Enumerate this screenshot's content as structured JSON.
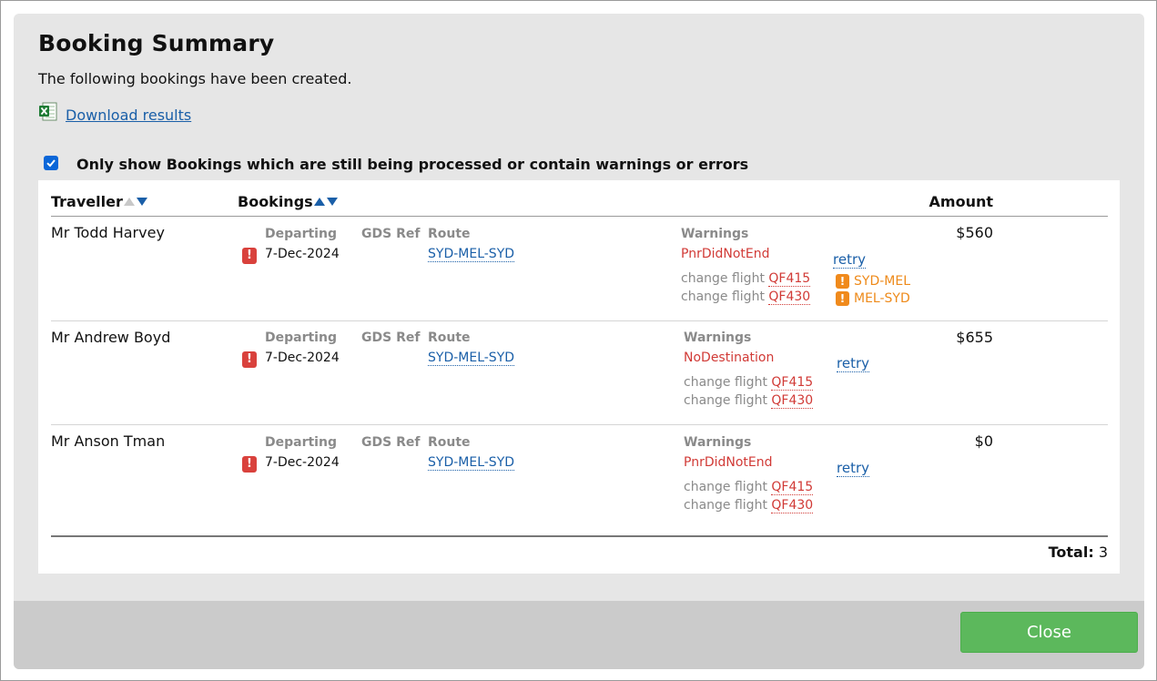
{
  "dialog": {
    "title": "Booking Summary",
    "intro": "The following bookings have been created.",
    "download_label": "Download results",
    "filter_label": "Only show Bookings which are still being processed or contain warnings or errors",
    "filter_checked": true
  },
  "table": {
    "headers": {
      "traveller": "Traveller",
      "bookings": "Bookings",
      "amount": "Amount"
    },
    "sub_headers": {
      "departing": "Departing",
      "gds_ref": "GDS Ref",
      "route": "Route",
      "warnings": "Warnings"
    },
    "retry_label": "retry",
    "change_label": "change flight",
    "rows": [
      {
        "traveller": "Mr Todd Harvey",
        "departing": "7-Dec-2024",
        "route": "SYD-MEL-SYD",
        "warning": "PnrDidNotEnd",
        "flight1": "QF415",
        "flight2": "QF430",
        "segment1": "SYD-MEL",
        "segment2": "MEL-SYD",
        "amount": "$560"
      },
      {
        "traveller": "Mr Andrew Boyd",
        "departing": "7-Dec-2024",
        "route": "SYD-MEL-SYD",
        "warning": "NoDestination",
        "flight1": "QF415",
        "flight2": "QF430",
        "amount": "$655"
      },
      {
        "traveller": "Mr Anson Tman",
        "departing": "7-Dec-2024",
        "route": "SYD-MEL-SYD",
        "warning": "PnrDidNotEnd",
        "flight1": "QF415",
        "flight2": "QF430",
        "amount": "$0"
      }
    ],
    "total_label": "Total:",
    "total_value": "3"
  },
  "footer": {
    "close_label": "Close"
  },
  "colors": {
    "link": "#1a5fa8",
    "error": "#d13a36",
    "warning": "#f08a1c",
    "close_button": "#5cb85c"
  },
  "icons": {
    "download": "excel-icon",
    "error": "exclamation-error-icon",
    "warning": "exclamation-warning-icon",
    "sort": "sort-arrows-icon"
  }
}
